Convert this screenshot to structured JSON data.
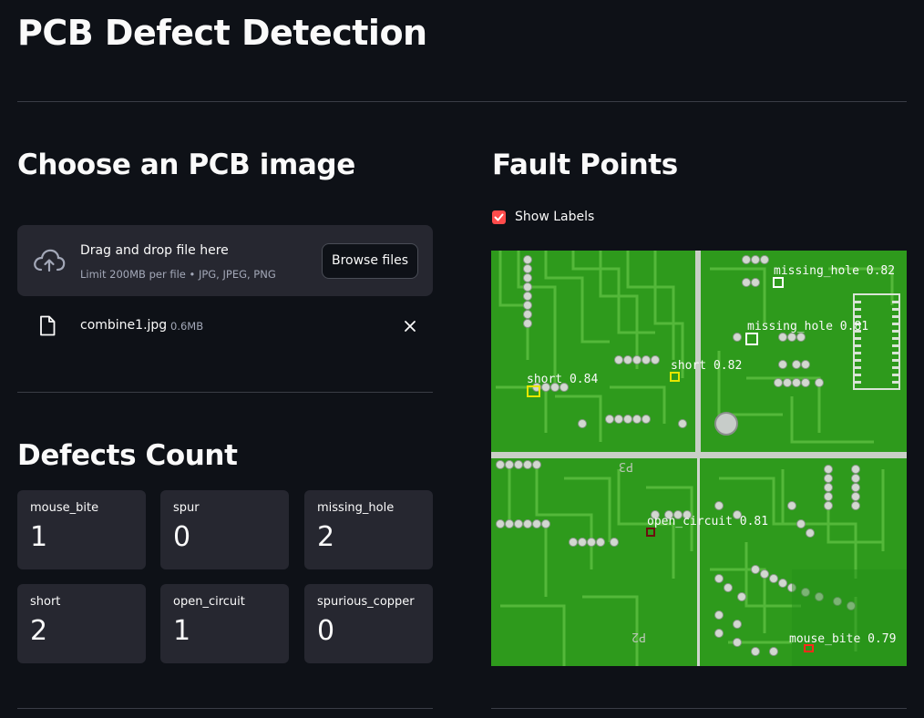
{
  "page": {
    "title": "PCB Defect Detection"
  },
  "uploader": {
    "heading": "Choose an PCB image",
    "drop_text": "Drag and drop file here",
    "limit_text": "Limit 200MB per file • JPG, JPEG, PNG",
    "browse_label": "Browse files",
    "file": {
      "name": "combine1.jpg",
      "size": "0.6MB"
    }
  },
  "defects": {
    "heading": "Defects Count",
    "items": [
      {
        "label": "mouse_bite",
        "value": "1"
      },
      {
        "label": "spur",
        "value": "0"
      },
      {
        "label": "missing_hole",
        "value": "2"
      },
      {
        "label": "short",
        "value": "2"
      },
      {
        "label": "open_circuit",
        "value": "1"
      },
      {
        "label": "spurious_copper",
        "value": "0"
      }
    ]
  },
  "fault_points": {
    "heading": "Fault Points",
    "show_labels": {
      "label": "Show Labels",
      "checked": true
    },
    "detections": [
      {
        "label": "missing_hole 0.82",
        "color": "#ffffff",
        "text_color": "#1a1a1a"
      },
      {
        "label": "missing_hole 0.81",
        "color": "#ffffff",
        "text_color": "#1a1a1a"
      },
      {
        "label": "short 0.84",
        "color": "#e6e600",
        "text_color": "#1a1a1a"
      },
      {
        "label": "short 0.82",
        "color": "#e6e600",
        "text_color": "#1a1a1a"
      },
      {
        "label": "open_circuit 0.81",
        "color": "#6b0f0f",
        "text_color": "#ffffff"
      },
      {
        "label": "mouse_bite 0.79",
        "color": "#ff2a1a",
        "text_color": "#ffffff"
      }
    ]
  },
  "colors": {
    "accent": "#ff4b4b",
    "background": "#0e1117",
    "card": "#262730"
  }
}
